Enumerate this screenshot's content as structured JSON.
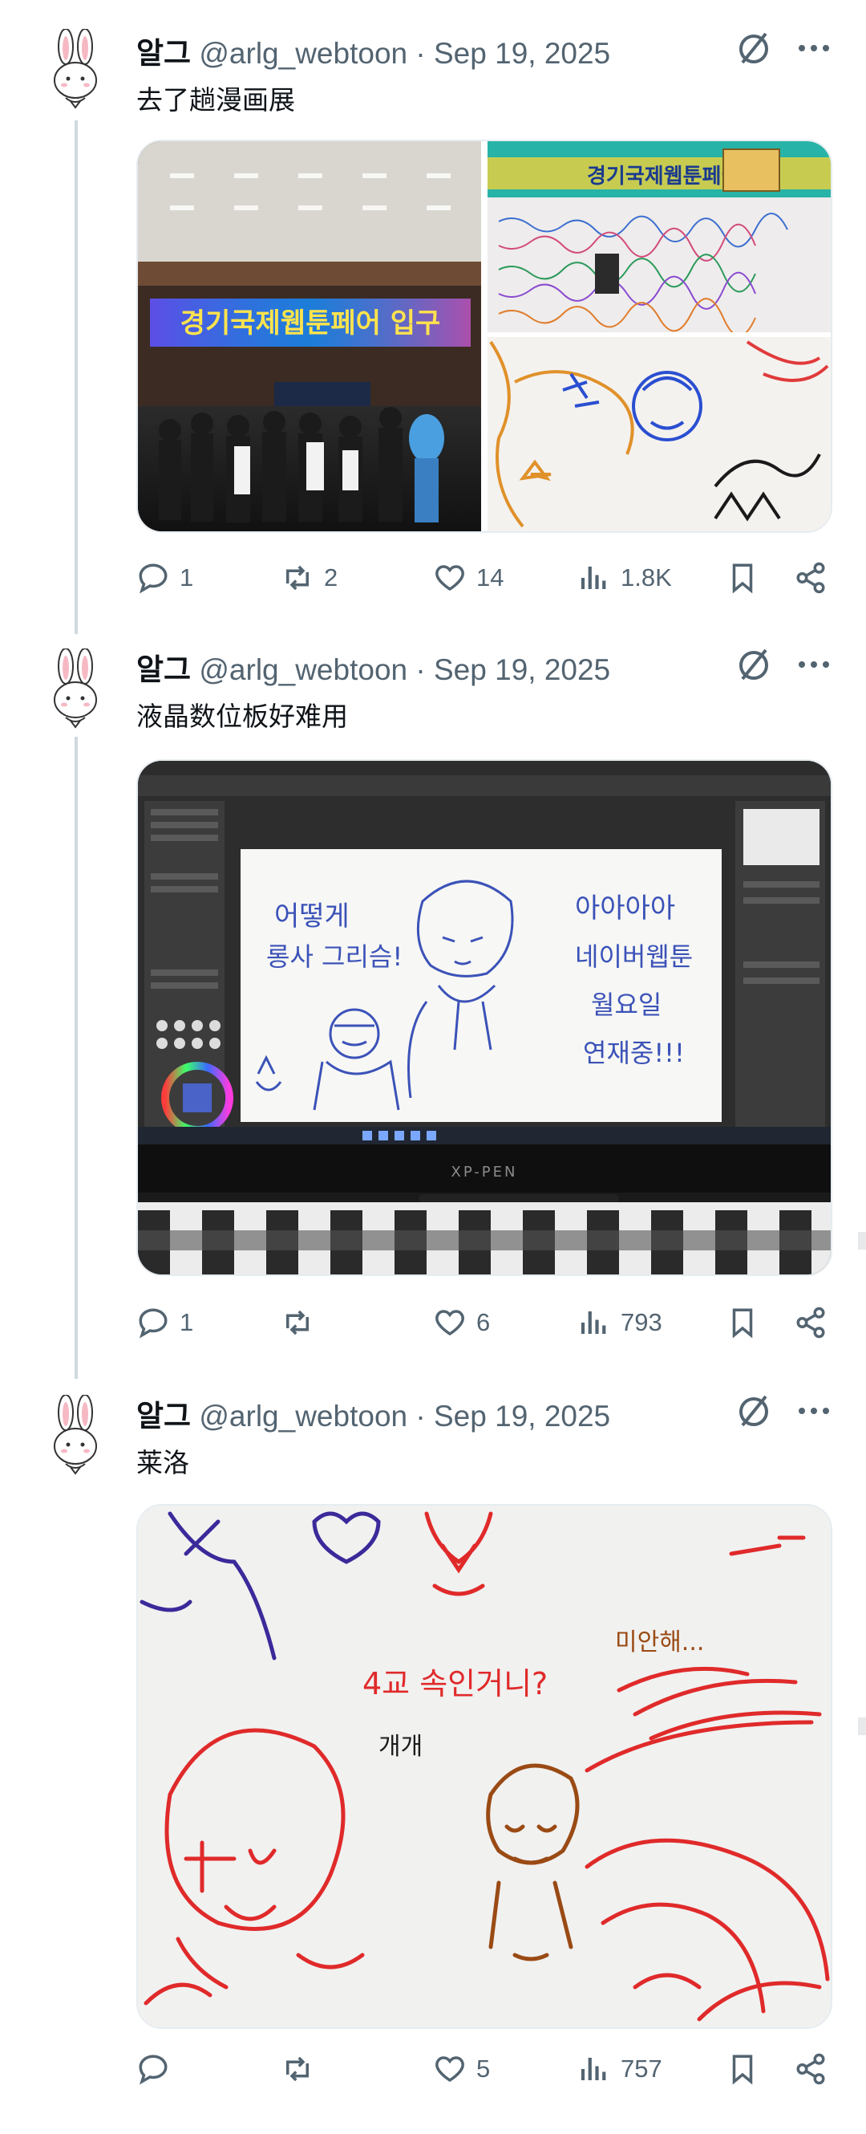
{
  "tweets": [
    {
      "author": "알그",
      "handle": "@arlg_webtoon",
      "date": "Sep 19, 2025",
      "text": "去了趟漫画展",
      "media_texts": [
        "경기국제웹툰페어 입구",
        "경기국제웹툰페어"
      ],
      "replies": "1",
      "retweets": "2",
      "likes": "14",
      "views": "1.8K"
    },
    {
      "author": "알그",
      "handle": "@arlg_webtoon",
      "date": "Sep 19, 2025",
      "text": "液晶数位板好难用",
      "media_texts": [
        "어떻게",
        "롱사 그리슴!",
        "아아아아",
        "네이버웹툰",
        "월요일",
        "연재중!!!",
        "XP-PEN"
      ],
      "replies": "1",
      "retweets": "",
      "likes": "6",
      "views": "793"
    },
    {
      "author": "알그",
      "handle": "@arlg_webtoon",
      "date": "Sep 19, 2025",
      "text": "莱洛",
      "media_texts": [
        "4교 속인거니?",
        "개개",
        "미안해..."
      ],
      "replies": "",
      "retweets": "",
      "likes": "5",
      "views": "757"
    }
  ],
  "icons": {
    "reply": "reply-icon",
    "retweet": "retweet-icon",
    "like": "heart-icon",
    "views": "views-icon",
    "bookmark": "bookmark-icon",
    "share": "share-icon",
    "grok": "grok-icon",
    "more": "more-icon"
  },
  "colors": {
    "meta": "#536471",
    "text": "#0f1419",
    "thread": "#cfd9de"
  }
}
